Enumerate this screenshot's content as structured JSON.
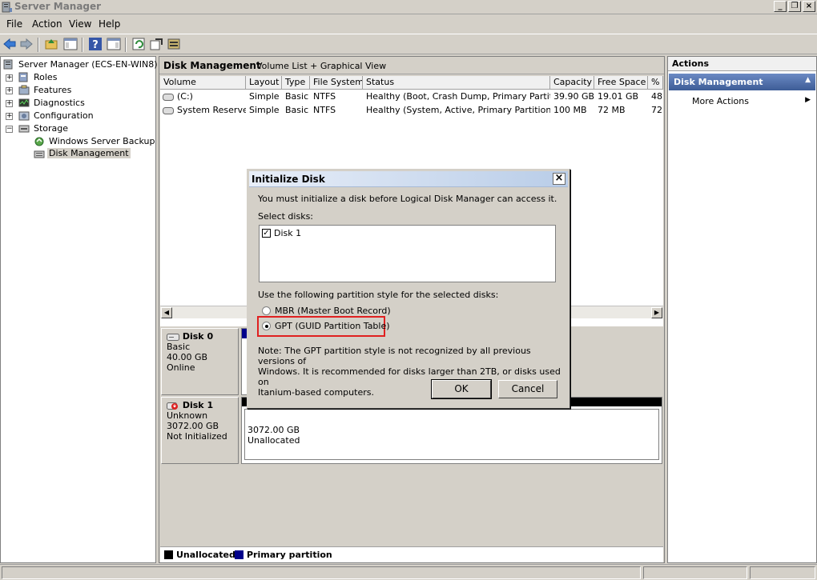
{
  "window": {
    "title": "Server Manager",
    "min_label": "_",
    "restore_label": "❐",
    "close_label": "×"
  },
  "menu": [
    "File",
    "Action",
    "View",
    "Help"
  ],
  "tree": {
    "root": "Server Manager (ECS-EN-WIN8)",
    "roles": "Roles",
    "features": "Features",
    "diagnostics": "Diagnostics",
    "configuration": "Configuration",
    "storage": "Storage",
    "backup": "Windows Server Backup",
    "disk_mgmt": "Disk Management",
    "expand": "+",
    "collapse": "−"
  },
  "center": {
    "title": "Disk Management",
    "subtitle": "Volume List + Graphical View",
    "columns": [
      "Volume",
      "Layout",
      "Type",
      "File System",
      "Status",
      "Capacity",
      "Free Space",
      "%"
    ],
    "rows": [
      [
        "(C:)",
        "Simple",
        "Basic",
        "NTFS",
        "Healthy (Boot, Crash Dump, Primary Partition)",
        "39.90 GB",
        "19.01 GB",
        "48"
      ],
      [
        "System Reserved",
        "Simple",
        "Basic",
        "NTFS",
        "Healthy (System, Active, Primary Partition)",
        "100 MB",
        "72 MB",
        "72"
      ]
    ],
    "disk0": {
      "name": "Disk 0",
      "type": "Basic",
      "size": "40.00 GB",
      "state": "Online"
    },
    "disk1": {
      "name": "Disk 1",
      "type": "Unknown",
      "size": "3072.00 GB",
      "state": "Not Initialized",
      "part_size": "3072.00 GB",
      "part_label": "Unallocated"
    },
    "legend": {
      "unallocated": "Unallocated",
      "primary": "Primary partition",
      "unallocated_color": "#000000",
      "primary_color": "#00008b"
    }
  },
  "actions": {
    "title": "Actions",
    "section": "Disk Management",
    "more": "More Actions"
  },
  "dialog": {
    "title": "Initialize Disk",
    "close": "×",
    "intro": "You must initialize a disk before Logical Disk Manager can access it.",
    "select_label": "Select disks:",
    "disks": [
      "Disk 1"
    ],
    "style_label": "Use the following partition style for the selected disks:",
    "mbr": "MBR (Master Boot Record)",
    "gpt": "GPT (GUID Partition Table)",
    "note_1": "Note: The GPT partition style is not recognized by all previous versions of",
    "note_2": "Windows. It is recommended for disks larger than 2TB, or disks used on",
    "note_3": "Itanium-based computers.",
    "ok": "OK",
    "cancel": "Cancel",
    "checked_mark": "✓",
    "highlight_color": "#e02020"
  }
}
